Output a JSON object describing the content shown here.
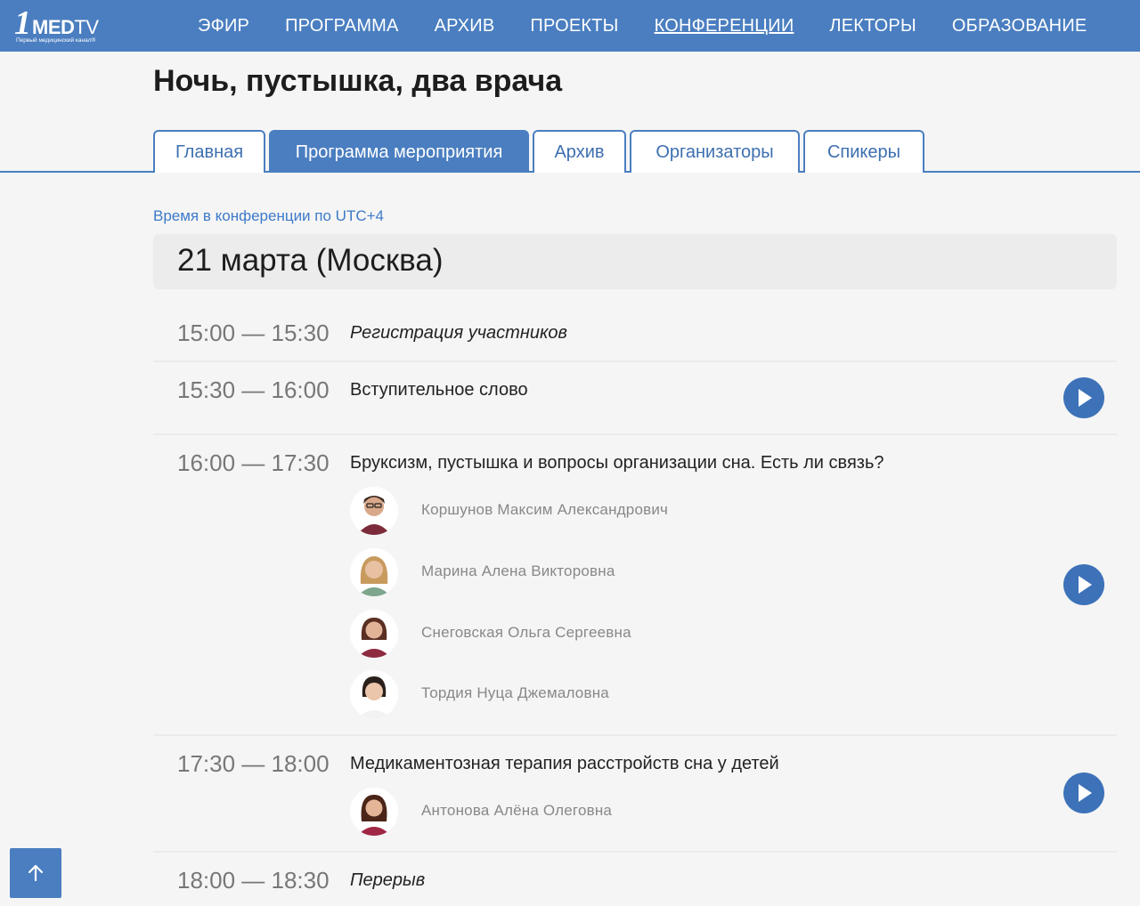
{
  "logo": {
    "brand_one": "1",
    "brand_med": "MED",
    "brand_tv": "TV",
    "tagline": "Первый медицинский канал®"
  },
  "nav": [
    {
      "label": "ЭФИР",
      "active": false
    },
    {
      "label": "ПРОГРАММА",
      "active": false
    },
    {
      "label": "АРХИВ",
      "active": false
    },
    {
      "label": "ПРОЕКТЫ",
      "active": false
    },
    {
      "label": "КОНФЕРЕНЦИИ",
      "active": true
    },
    {
      "label": "ЛЕКТОРЫ",
      "active": false
    },
    {
      "label": "ОБРАЗОВАНИЕ",
      "active": false
    }
  ],
  "page_title": "Ночь, пустышка, два врача",
  "tabs": [
    {
      "label": "Главная",
      "active": false
    },
    {
      "label": "Программа мероприятия",
      "active": true
    },
    {
      "label": "Архив",
      "active": false
    },
    {
      "label": "Организаторы",
      "active": false
    },
    {
      "label": "Спикеры",
      "active": false
    }
  ],
  "timezone_note": "Время в конференции по UTC+4",
  "day_heading": "21 марта (Москва)",
  "schedule": [
    {
      "time": "15:00 — 15:30",
      "topic": "Регистрация участников",
      "italic": true,
      "has_video": false,
      "speakers": []
    },
    {
      "time": "15:30 — 16:00",
      "topic": "Вступительное слово",
      "italic": false,
      "has_video": true,
      "speakers": []
    },
    {
      "time": "16:00 — 17:30",
      "topic": "Бруксизм, пустышка и вопросы организации сна. Есть ли связь?",
      "italic": false,
      "has_video": true,
      "speakers": [
        {
          "name": "Коршунов Максим Александрович"
        },
        {
          "name": "Марина Алена Викторовна"
        },
        {
          "name": "Снеговская Ольга Сергеевна"
        },
        {
          "name": "Тордия Нуца Джемаловна"
        }
      ]
    },
    {
      "time": "17:30 — 18:00",
      "topic": "Медикаментозная терапия расстройств сна у детей",
      "italic": false,
      "has_video": true,
      "speakers": [
        {
          "name": "Антонова Алёна Олеговна"
        }
      ]
    },
    {
      "time": "18:00 — 18:30",
      "topic": "Перерыв",
      "italic": true,
      "has_video": false,
      "speakers": []
    }
  ],
  "colors": {
    "brand_blue": "#4a7ec0",
    "play_blue": "#3d72b8",
    "link_blue": "#3d7ac9"
  },
  "icons": {
    "play": "play-icon",
    "scroll_top": "arrow-up-icon"
  }
}
